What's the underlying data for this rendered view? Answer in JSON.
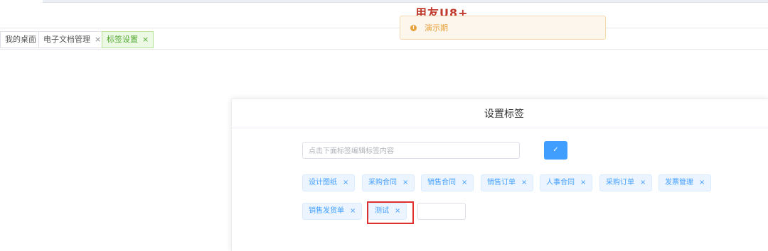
{
  "header": {
    "logo_text": "用友U8+"
  },
  "tabs": [
    {
      "label": "我的桌面",
      "closable": false
    },
    {
      "label": "电子文档管理",
      "closable": true,
      "close_glyph": "×"
    },
    {
      "label": "标签设置",
      "closable": true,
      "close_glyph": "×",
      "active": true
    }
  ],
  "notice": {
    "icon": "warning-icon",
    "text": "演示期",
    "color": "#e6a23c"
  },
  "dialog": {
    "title": "设置标签",
    "input": {
      "placeholder": "点击下面标签编辑标签内容",
      "value": ""
    },
    "confirm_button": {
      "label": "✓",
      "color": "#409eff"
    },
    "tags": [
      {
        "label": "设计图纸",
        "close": "×"
      },
      {
        "label": "采购合同",
        "close": "×"
      },
      {
        "label": "销售合同",
        "close": "×"
      },
      {
        "label": "销售订单",
        "close": "×"
      },
      {
        "label": "人事合同",
        "close": "×"
      },
      {
        "label": "采购订单",
        "close": "×"
      },
      {
        "label": "发票管理",
        "close": "×"
      },
      {
        "label": "销售发货单",
        "close": "×"
      },
      {
        "label": "测试",
        "close": "×"
      }
    ],
    "new_tag_input": {
      "value": ""
    },
    "tag_color": "#409eff",
    "highlight_color": "#e02f2f"
  }
}
